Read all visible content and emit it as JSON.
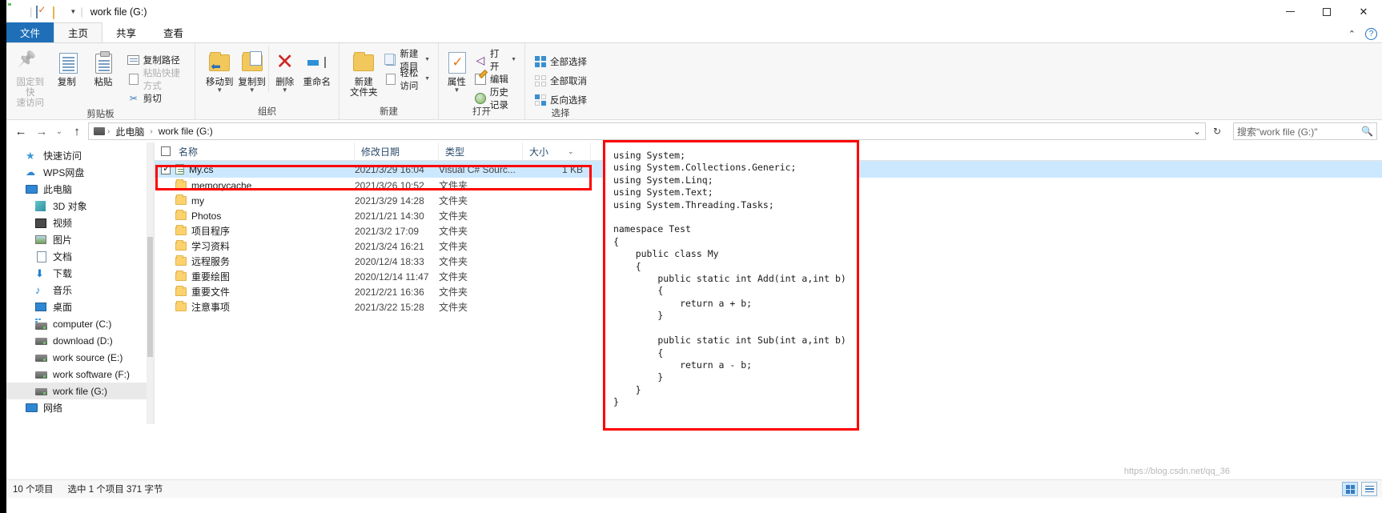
{
  "window": {
    "title": "work file (G:)",
    "quick_access": [
      "save-icon",
      "properties-icon",
      "folder-icon",
      "dropdown-caret"
    ],
    "controls": {
      "minimize": "—",
      "maximize": "□",
      "close": "✕"
    }
  },
  "ribbon": {
    "tabs": [
      {
        "label": "文件",
        "kind": "file"
      },
      {
        "label": "主页",
        "kind": "active"
      },
      {
        "label": "共享",
        "kind": "normal"
      },
      {
        "label": "查看",
        "kind": "normal"
      }
    ],
    "collapse_caret": "⌃",
    "help_label": "?",
    "groups": [
      {
        "name": "剪贴板",
        "big": [
          {
            "label": "固定到快\n速访问",
            "icon": "pin-icon",
            "disabled": true
          },
          {
            "label": "复制",
            "icon": "copy-icon",
            "disabled": false
          },
          {
            "label": "粘贴",
            "icon": "paste-icon",
            "disabled": false
          }
        ],
        "small": [
          {
            "label": "复制路径",
            "icon": "copy-path-icon"
          },
          {
            "label": "粘贴快捷方式",
            "icon": "paste-shortcut-icon",
            "disabled": true
          },
          {
            "label": "剪切",
            "icon": "scissors-icon"
          }
        ]
      },
      {
        "name": "组织",
        "big": [
          {
            "label": "移动到",
            "icon": "move-to-icon",
            "caret": true
          },
          {
            "label": "复制到",
            "icon": "copy-to-icon",
            "caret": true
          },
          {
            "label": "删除",
            "icon": "delete-icon",
            "caret": true
          },
          {
            "label": "重命名",
            "icon": "rename-icon"
          }
        ]
      },
      {
        "name": "新建",
        "big": [
          {
            "label": "新建\n文件夹",
            "icon": "new-folder-icon"
          }
        ],
        "small": [
          {
            "label": "新建项目",
            "icon": "new-item-icon",
            "caret": true
          },
          {
            "label": "轻松访问",
            "icon": "easy-access-icon",
            "caret": true
          }
        ]
      },
      {
        "name": "打开",
        "big": [
          {
            "label": "属性",
            "icon": "properties-icon",
            "caret": true
          }
        ],
        "small": [
          {
            "label": "打开",
            "icon": "visual-studio-icon",
            "caret": true
          },
          {
            "label": "编辑",
            "icon": "edit-icon"
          },
          {
            "label": "历史记录",
            "icon": "history-icon"
          }
        ]
      },
      {
        "name": "选择",
        "small": [
          {
            "label": "全部选择",
            "icon": "select-all-icon"
          },
          {
            "label": "全部取消",
            "icon": "select-none-icon"
          },
          {
            "label": "反向选择",
            "icon": "invert-selection-icon"
          }
        ]
      }
    ]
  },
  "addressbar": {
    "back": "←",
    "forward": "→",
    "recent": "⌄",
    "up": "↑",
    "breadcrumbs": [
      "此电脑",
      "work file (G:)"
    ],
    "dropdown": "⌄",
    "refresh": "↻",
    "search_placeholder": "搜索\"work file (G:)\"",
    "search_value": ""
  },
  "navpane": {
    "items": [
      {
        "label": "快速访问",
        "icon": "star-icon",
        "indent": 0
      },
      {
        "label": "WPS网盘",
        "icon": "cloud-icon",
        "indent": 0
      },
      {
        "label": "此电脑",
        "icon": "computer-icon",
        "indent": 0
      },
      {
        "label": "3D 对象",
        "icon": "3d-objects-icon",
        "indent": 1
      },
      {
        "label": "视频",
        "icon": "videos-icon",
        "indent": 1
      },
      {
        "label": "图片",
        "icon": "pictures-icon",
        "indent": 1
      },
      {
        "label": "文档",
        "icon": "documents-icon",
        "indent": 1
      },
      {
        "label": "下载",
        "icon": "downloads-icon",
        "indent": 1
      },
      {
        "label": "音乐",
        "icon": "music-icon",
        "indent": 1
      },
      {
        "label": "桌面",
        "icon": "desktop-icon",
        "indent": 1
      },
      {
        "label": "computer (C:)",
        "icon": "system-drive-icon",
        "indent": 1
      },
      {
        "label": "download (D:)",
        "icon": "drive-icon",
        "indent": 1
      },
      {
        "label": "work source (E:)",
        "icon": "drive-icon",
        "indent": 1
      },
      {
        "label": "work software (F:)",
        "icon": "drive-icon",
        "indent": 1
      },
      {
        "label": "work file (G:)",
        "icon": "drive-icon",
        "indent": 1,
        "selected": true
      },
      {
        "label": "网络",
        "icon": "network-icon",
        "indent": 0
      }
    ]
  },
  "filelist": {
    "columns": [
      {
        "label": "名称",
        "key": "name"
      },
      {
        "label": "修改日期",
        "key": "date"
      },
      {
        "label": "类型",
        "key": "type"
      },
      {
        "label": "大小",
        "key": "size",
        "sort_caret": "⌄"
      }
    ],
    "select_all_checked": false,
    "rows": [
      {
        "name": "My.cs",
        "date": "2021/3/29 16:04",
        "type": "Visual C# Sourc...",
        "size": "1 KB",
        "icon": "csharp-file-icon",
        "selected": true,
        "checked": true
      },
      {
        "name": "memorycache",
        "date": "2021/3/26 10:52",
        "type": "文件夹",
        "size": "",
        "icon": "folder-icon"
      },
      {
        "name": "my",
        "date": "2021/3/29 14:28",
        "type": "文件夹",
        "size": "",
        "icon": "folder-icon"
      },
      {
        "name": "Photos",
        "date": "2021/1/21 14:30",
        "type": "文件夹",
        "size": "",
        "icon": "folder-icon"
      },
      {
        "name": "项目程序",
        "date": "2021/3/2 17:09",
        "type": "文件夹",
        "size": "",
        "icon": "folder-icon"
      },
      {
        "name": "学习资料",
        "date": "2021/3/24 16:21",
        "type": "文件夹",
        "size": "",
        "icon": "folder-icon"
      },
      {
        "name": "远程服务",
        "date": "2020/12/4 18:33",
        "type": "文件夹",
        "size": "",
        "icon": "folder-icon"
      },
      {
        "name": "重要绘图",
        "date": "2020/12/14 11:47",
        "type": "文件夹",
        "size": "",
        "icon": "folder-icon"
      },
      {
        "name": "重要文件",
        "date": "2021/2/21 16:36",
        "type": "文件夹",
        "size": "",
        "icon": "folder-icon"
      },
      {
        "name": "注意事项",
        "date": "2021/3/22 15:28",
        "type": "文件夹",
        "size": "",
        "icon": "folder-icon"
      }
    ]
  },
  "code_panel": {
    "language": "csharp",
    "text": "using System;\nusing System.Collections.Generic;\nusing System.Linq;\nusing System.Text;\nusing System.Threading.Tasks;\n\nnamespace Test\n{\n    public class My\n    {\n        public static int Add(int a,int b)\n        {\n            return a + b;\n        }\n\n        public static int Sub(int a,int b)\n        {\n            return a - b;\n        }\n    }\n}"
  },
  "statusbar": {
    "item_count": "10 个项目",
    "selection": "选中 1 个项目  371 字节",
    "view_tiles": "tiles-view-icon",
    "view_details": "details-view-icon"
  },
  "watermark": "https://blog.csdn.net/qq_36",
  "colors": {
    "accent": "#1e6fb8",
    "selection": "#cce8ff",
    "highlight_box": "#ff0000",
    "ribbon_bg": "#f7f7f7"
  }
}
